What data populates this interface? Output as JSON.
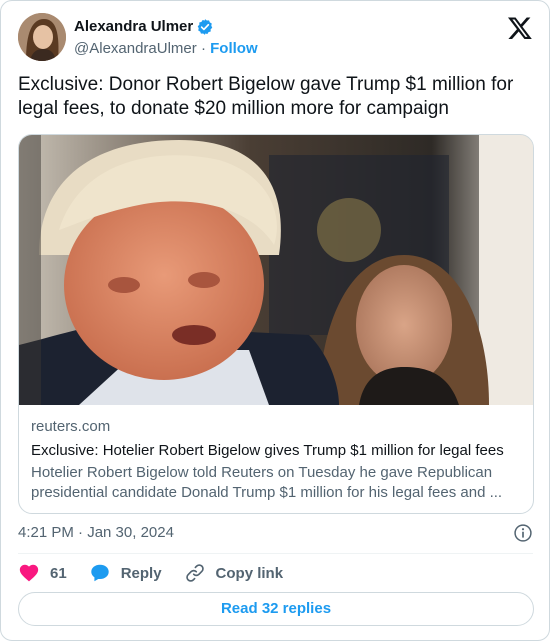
{
  "author": {
    "display_name": "Alexandra Ulmer",
    "handle": "@AlexandraUlmer",
    "separator": "·",
    "follow_label": "Follow",
    "verified": true,
    "avatar_icon": "avatar-photo"
  },
  "tweet": {
    "text": "Exclusive: Donor Robert Bigelow gave Trump $1 million for legal fees, to donate $20 million more for campaign",
    "timestamp": "4:21 PM · Jan 30, 2024"
  },
  "link_card": {
    "domain": "reuters.com",
    "title": "Exclusive: Hotelier Robert Bigelow gives Trump $1 million for legal fees",
    "description_line1": "Hotelier Robert Bigelow told Reuters on Tuesday he gave Republican",
    "description_line2": "presidential candidate Donald Trump $1 million for his legal fees and ...",
    "image_icon": "news-photo"
  },
  "actions": {
    "like_count": "61",
    "reply_label": "Reply",
    "copy_link_label": "Copy link"
  },
  "footer": {
    "read_replies_label": "Read 32 replies"
  },
  "colors": {
    "accent": "#1d9bf0",
    "like": "#f91880",
    "text": "#0f1419",
    "secondary": "#536471",
    "border": "#cfd9de"
  }
}
